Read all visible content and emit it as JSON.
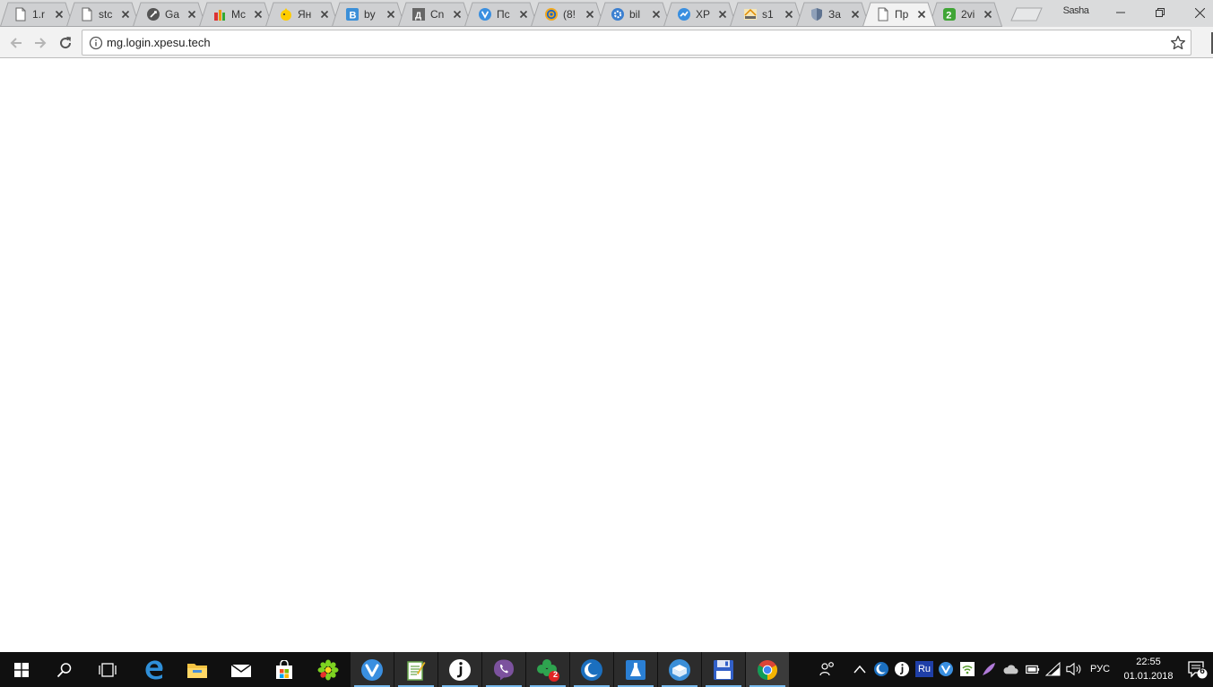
{
  "browser": {
    "tabs": [
      {
        "title": "1.r",
        "icon": "page-icon"
      },
      {
        "title": "stc",
        "icon": "page-icon"
      },
      {
        "title": "Ga",
        "icon": "rocket-icon"
      },
      {
        "title": "Mc",
        "icon": "tools-icon"
      },
      {
        "title": "Ян",
        "icon": "yandex-icon"
      },
      {
        "title": "by",
        "icon": "b-logo-icon"
      },
      {
        "title": "Cn",
        "icon": "d-logo-icon"
      },
      {
        "title": "Пс",
        "icon": "v-circle-icon"
      },
      {
        "title": "(8!",
        "icon": "at-icon"
      },
      {
        "title": "bil",
        "icon": "gear-circle-icon"
      },
      {
        "title": "XP",
        "icon": "xp-icon"
      },
      {
        "title": "s1",
        "icon": "pma-icon"
      },
      {
        "title": "За",
        "icon": "shield-icon"
      },
      {
        "title": "Пр",
        "icon": "page-icon",
        "active": true
      },
      {
        "title": "2vi",
        "icon": "two-icon"
      }
    ],
    "profile_name": "Sasha",
    "url": "mg.login.xpesu.tech"
  },
  "taskbar": {
    "language": "РУС",
    "time": "22:55",
    "date": "01.01.2018",
    "notification_count": "6",
    "tray_ru_label": "Ru",
    "badge_count": "2"
  },
  "colors": {
    "taskbar_bg": "#101010",
    "tab_strip_bg": "#dadbdc",
    "toolbar_bg": "#f2f2f2",
    "accent": "#76b9ed"
  }
}
